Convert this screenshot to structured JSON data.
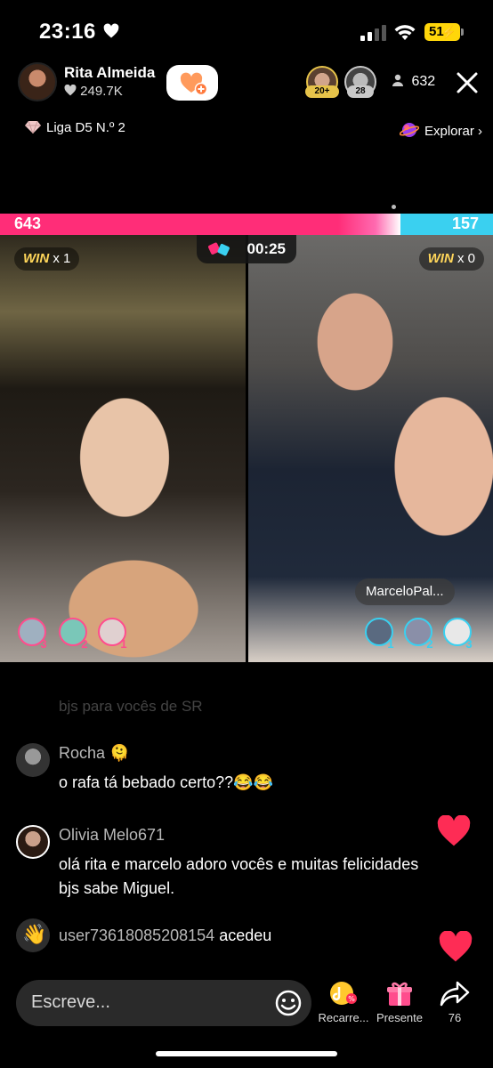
{
  "status_bar": {
    "time": "23:16",
    "battery": "51"
  },
  "host": {
    "name": "Rita Almeida",
    "likes": "249.7K"
  },
  "top_viewers": [
    {
      "badge": "20+"
    },
    {
      "badge": "28"
    }
  ],
  "viewer_count": "632",
  "league": "Liga D5 N.º 2",
  "explore": "Explorar",
  "battle": {
    "score_left": "643",
    "score_right": "157",
    "timer": "00:25",
    "left_win_label": "WIN",
    "left_win_count": "x 1",
    "right_win_label": "WIN",
    "right_win_count": "x 0",
    "opponent_name": "MarceloPal...",
    "left_ranks": [
      "3",
      "2",
      "1"
    ],
    "right_ranks": [
      "1",
      "2",
      "3"
    ]
  },
  "chat": {
    "faded_line": "bjs para vocês de SR",
    "messages": [
      {
        "user": "Rocha",
        "text": "o rafa tá bebado certo??😂😂"
      },
      {
        "user": "Olivia Melo671",
        "text": "olá rita e marcelo adoro vocês e muitas felicidades bjs sabe Miguel."
      }
    ],
    "joined": {
      "user": "user73618085208154",
      "action": "acedeu"
    }
  },
  "bottom": {
    "placeholder": "Escreve...",
    "recharge_label": "Recarre...",
    "gift_label": "Presente",
    "share_count": "76"
  },
  "colors": {
    "pink": "#ff2d78",
    "cyan": "#3ad0f0",
    "heart_red": "#fe2c55",
    "win_gold": "#ffd65a"
  },
  "icons": [
    "heart-icon",
    "signal-icon",
    "wifi-icon",
    "battery-icon",
    "follow-heart-icon",
    "person-icon",
    "close-icon",
    "gem-icon",
    "planet-icon",
    "battle-icon",
    "emoji-icon",
    "recharge-icon",
    "gift-icon",
    "share-icon"
  ]
}
